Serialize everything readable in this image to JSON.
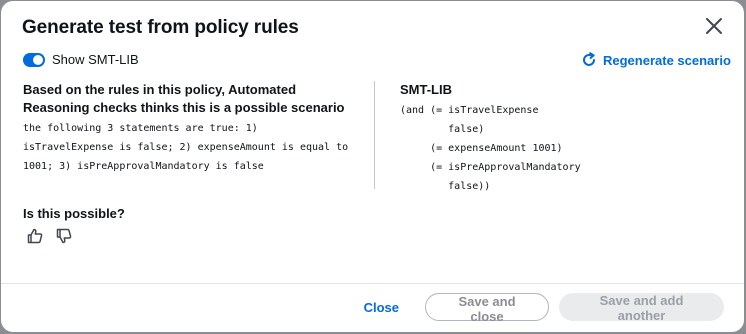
{
  "modal": {
    "title": "Generate test from policy rules",
    "close_label": "Close dialog"
  },
  "toggle": {
    "label": "Show SMT-LIB",
    "checked": true
  },
  "regenerate": {
    "label": "Regenerate scenario"
  },
  "scenario": {
    "heading_line1": "Based on the rules in this policy, Automated",
    "heading_line2": "Reasoning checks thinks this is a possible scenario",
    "body_line1": "the following 3 statements are true: 1)",
    "body_line2": "isTravelExpense is false; 2) expenseAmount is equal to",
    "body_line3": "1001; 3) isPreApprovalMandatory is false"
  },
  "smt": {
    "heading": "SMT-LIB",
    "lines": [
      "(and (= isTravelExpense",
      "        false)",
      "     (= expenseAmount 1001)",
      "     (= isPreApprovalMandatory",
      "        false))"
    ]
  },
  "feedback": {
    "question": "Is this possible?",
    "thumbs_up_icon": "thumbs-up-icon",
    "thumbs_down_icon": "thumbs-down-icon"
  },
  "footer": {
    "close_label": "Close",
    "save_close_label": "Save and close",
    "save_another_label": "Save and add another"
  },
  "colors": {
    "accent": "#006ce0",
    "disabled_bg": "#eaebed",
    "disabled_text": "#9ba0a8"
  }
}
